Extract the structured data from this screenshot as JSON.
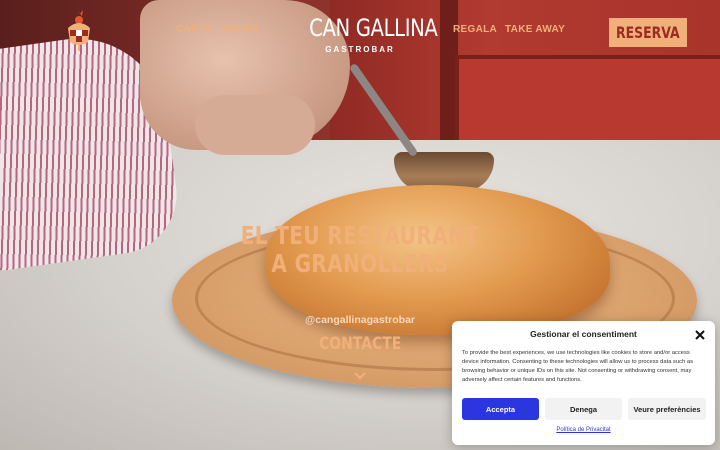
{
  "header": {
    "logo_icon": "rooster-logo-icon",
    "nav_left": [
      "CARTA",
      "GRUPS"
    ],
    "brand_name": "CAN GALLINA",
    "brand_sub": "GASTROBAR",
    "nav_right": [
      "REGALA",
      "TAKE AWAY"
    ],
    "reserve_label": "RESERVA"
  },
  "hero": {
    "headline_line1": "EL TEU RESTAURANT",
    "headline_line2": "A GRANOLLERS",
    "instagram_handle": "@cangallinagastrobar",
    "contact_label": "CONTACTE",
    "scroll_icon": "chevron-down-icon"
  },
  "consent": {
    "title": "Gestionar el consentiment",
    "close_icon": "close-icon",
    "text": "To provide the best experiences, we use technologies like cookies to store and/or access device information. Consenting to these technologies will allow us to process data such as browsing behavior or unique IDs on this site. Not consenting or withdrawing consent, may adversely affect certain features and functions.",
    "accept_label": "Accepta",
    "deny_label": "Denega",
    "prefs_label": "Veure preferències",
    "privacy_label": "Política de Privacitat"
  },
  "colors": {
    "accent": "#f1b07a",
    "reserve_text": "#9b2c20",
    "accept_button": "#2a36e0"
  }
}
